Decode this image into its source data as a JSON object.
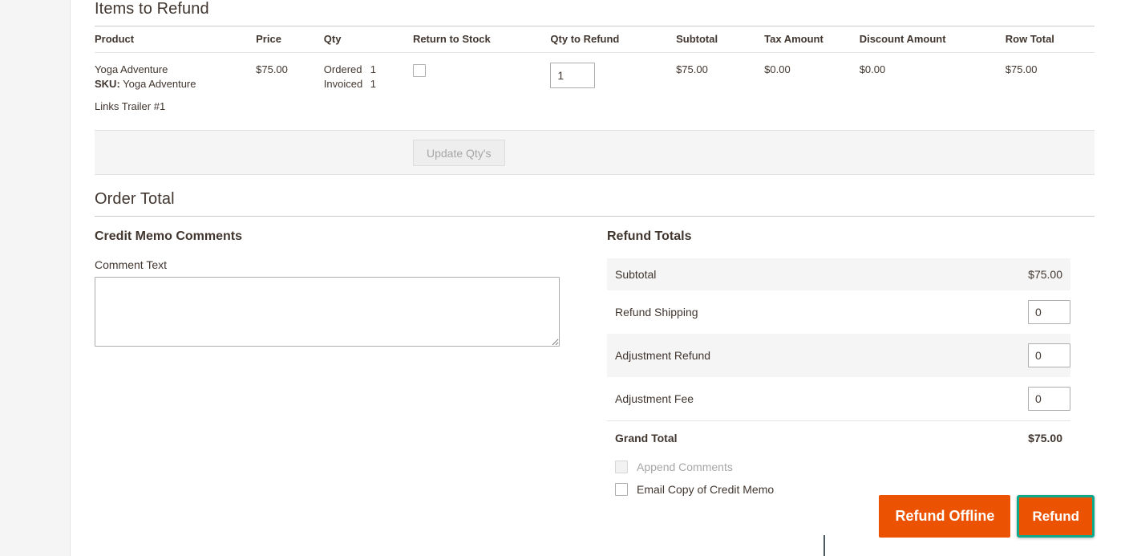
{
  "items_section": {
    "title": "Items to Refund",
    "columns": [
      "Product",
      "Price",
      "Qty",
      "Return to Stock",
      "Qty to Refund",
      "Subtotal",
      "Tax Amount",
      "Discount Amount",
      "Row Total"
    ],
    "rows": [
      {
        "product_name": "Yoga Adventure",
        "sku_label": "SKU:",
        "sku_value": "Yoga Adventure",
        "extra_label": "Links",
        "extra_value": "Trailer #1",
        "price": "$75.00",
        "qty_ordered_label": "Ordered",
        "qty_ordered_value": "1",
        "qty_invoiced_label": "Invoiced",
        "qty_invoiced_value": "1",
        "return_to_stock_checked": false,
        "qty_to_refund": "1",
        "subtotal": "$75.00",
        "tax_amount": "$0.00",
        "discount_amount": "$0.00",
        "row_total": "$75.00"
      }
    ],
    "update_qty_button": "Update Qty's",
    "update_qty_disabled": true
  },
  "order_total": {
    "title": "Order Total",
    "comments": {
      "heading": "Credit Memo Comments",
      "comment_label": "Comment Text",
      "comment_value": "",
      "comment_placeholder": ""
    },
    "refund_totals": {
      "heading": "Refund Totals",
      "rows": [
        {
          "label": "Subtotal",
          "type": "value",
          "value": "$75.00",
          "shaded": true
        },
        {
          "label": "Refund Shipping",
          "type": "input",
          "value": "0",
          "shaded": false
        },
        {
          "label": "Adjustment Refund",
          "type": "input",
          "value": "0",
          "shaded": true
        },
        {
          "label": "Adjustment Fee",
          "type": "input",
          "value": "0",
          "shaded": false
        }
      ],
      "grand_total_label": "Grand Total",
      "grand_total_value": "$75.00",
      "append_comments_label": "Append Comments",
      "append_comments_checked": false,
      "append_comments_disabled": true,
      "email_copy_label": "Email Copy of Credit Memo",
      "email_copy_checked": false
    }
  },
  "actions": {
    "refund_offline_label": "Refund Offline",
    "refund_label": "Refund",
    "primary_color": "#eb5202",
    "focus_outline_color": "#10a88a"
  }
}
